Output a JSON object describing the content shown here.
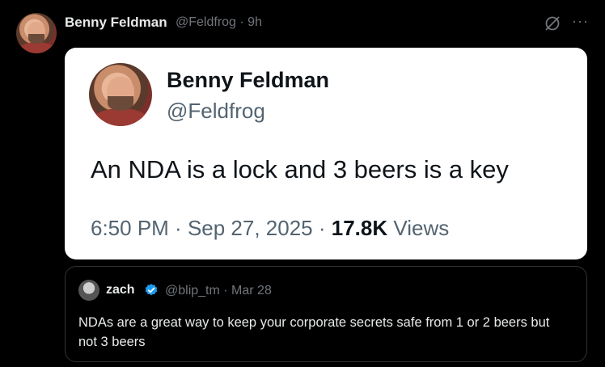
{
  "post": {
    "author_name": "Benny Feldman",
    "handle": "@Feldfrog",
    "separator": "·",
    "time_ago": "9h",
    "more_label": "···"
  },
  "screenshot": {
    "name": "Benny Feldman",
    "handle": "@Feldfrog",
    "text": "An NDA is a lock and 3 beers is a key",
    "time": "6:50 PM",
    "date": "Sep 27, 2025",
    "views_count": "17.8K",
    "views_label": "Views"
  },
  "quote": {
    "name": "zach",
    "handle": "@blip_tm",
    "date": "Mar 28",
    "text": "NDAs are a great way to keep your corporate secrets safe from 1 or 2 beers but not 3 beers"
  },
  "colors": {
    "background": "#000000",
    "verified": "#1d9bf0",
    "muted": "#71767b"
  },
  "icons": [
    "grok-icon",
    "more-icon",
    "verified-icon"
  ]
}
